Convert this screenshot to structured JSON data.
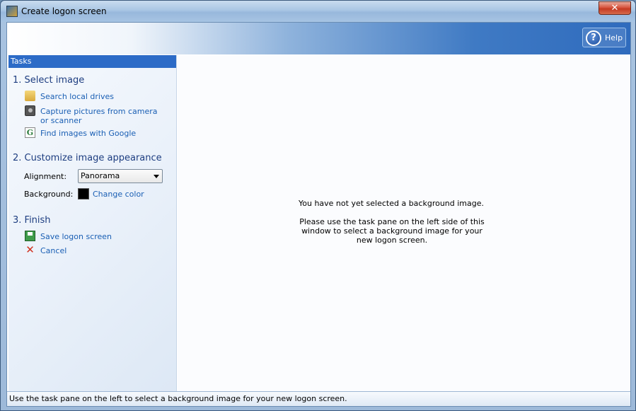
{
  "window": {
    "title": "Create logon screen",
    "close_label": "✕"
  },
  "banner": {
    "help_label": "Help"
  },
  "taskpane": {
    "header": "Tasks",
    "section1": {
      "title": "1. Select image",
      "items": [
        {
          "label": "Search local drives",
          "icon": "folder-icon"
        },
        {
          "label": "Capture pictures from camera or scanner",
          "icon": "camera-icon"
        },
        {
          "label": "Find images with Google",
          "icon": "google-icon"
        }
      ]
    },
    "section2": {
      "title": "2. Customize image appearance",
      "alignment_label": "Alignment:",
      "alignment_value": "Panorama",
      "background_label": "Background:",
      "background_color": "#000000",
      "change_color_label": "Change color"
    },
    "section3": {
      "title": "3. Finish",
      "items": [
        {
          "label": "Save logon screen",
          "icon": "save-icon"
        },
        {
          "label": "Cancel",
          "icon": "cancel-icon"
        }
      ]
    }
  },
  "preview": {
    "message_line1": "You have not yet selected a background image.",
    "message_line2": "Please use the task pane on the left side of this window to select a background image for your new logon screen."
  },
  "statusbar": {
    "text": "Use the task pane on the left to select a background image for your new logon screen."
  },
  "colors": {
    "accent": "#2c6bc7",
    "link": "#1a5fb4"
  }
}
